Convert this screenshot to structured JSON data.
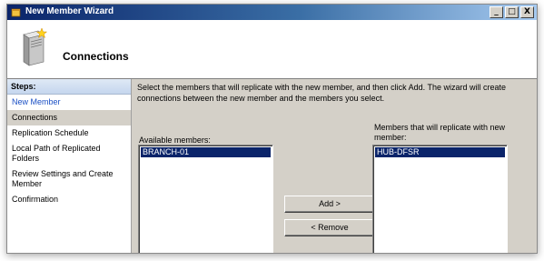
{
  "window": {
    "title": "New Member Wizard",
    "controls": {
      "minimize": "_",
      "maximize": "□",
      "close": "X"
    }
  },
  "header": {
    "title": "Connections",
    "icon": "server-icon"
  },
  "steps": {
    "heading": "Steps:",
    "items": [
      {
        "label": "New Member"
      },
      {
        "label": "Connections"
      },
      {
        "label": "Replication Schedule"
      },
      {
        "label": "Local Path of Replicated Folders"
      },
      {
        "label": "Review Settings and Create Member"
      },
      {
        "label": "Confirmation"
      }
    ],
    "current_index": 1
  },
  "main": {
    "instructions": "Select the members that will replicate with the new member, and then click Add. The wizard will create connections between the new member and the members you select.",
    "available_label": "Available members:",
    "available_items": [
      "BRANCH-01"
    ],
    "replicate_label": "Members that will replicate with new member:",
    "replicate_items": [
      "HUB-DFSR"
    ],
    "add_button": "Add >",
    "remove_button": "< Remove"
  },
  "colors": {
    "title_gradient_start": "#0a246a",
    "title_gradient_end": "#a6caf0",
    "selection": "#0a246a",
    "link": "#1a4fc4",
    "dialog_face": "#d4d0c8"
  }
}
